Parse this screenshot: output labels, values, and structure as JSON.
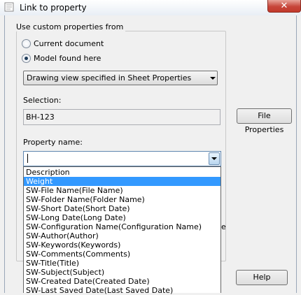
{
  "window": {
    "title": "Link to property",
    "close_glyph": "✕"
  },
  "source_group": {
    "legend": "Use custom properties from",
    "options": [
      "Current document",
      "Model found here"
    ],
    "selected_option": "Model found here",
    "select_value": "Drawing view specified in Sheet Properties"
  },
  "selection": {
    "label": "Selection:",
    "value": "BH-123"
  },
  "file_properties_button": "File Properties",
  "property_name": {
    "label": "Property name:",
    "value": "",
    "items": [
      "Description",
      "Weight",
      "SW-File Name(File Name)",
      "SW-Folder Name(Folder Name)",
      "SW-Short Date(Short Date)",
      "SW-Long Date(Long Date)",
      "SW-Configuration Name(Configuration Name)",
      "SW-Author(Author)",
      "SW-Keywords(Keywords)",
      "SW-Comments(Comments)",
      "SW-Title(Title)",
      "SW-Subject(Subject)",
      "SW-Created Date(Created Date)",
      "SW-Last Saved Date(Last Saved Date)"
    ],
    "highlighted_item": "Weight"
  },
  "clipped_text": "e",
  "help_button": "Help",
  "colors": {
    "selection_highlight": "#3399ff",
    "close_button": "#c7463a"
  }
}
